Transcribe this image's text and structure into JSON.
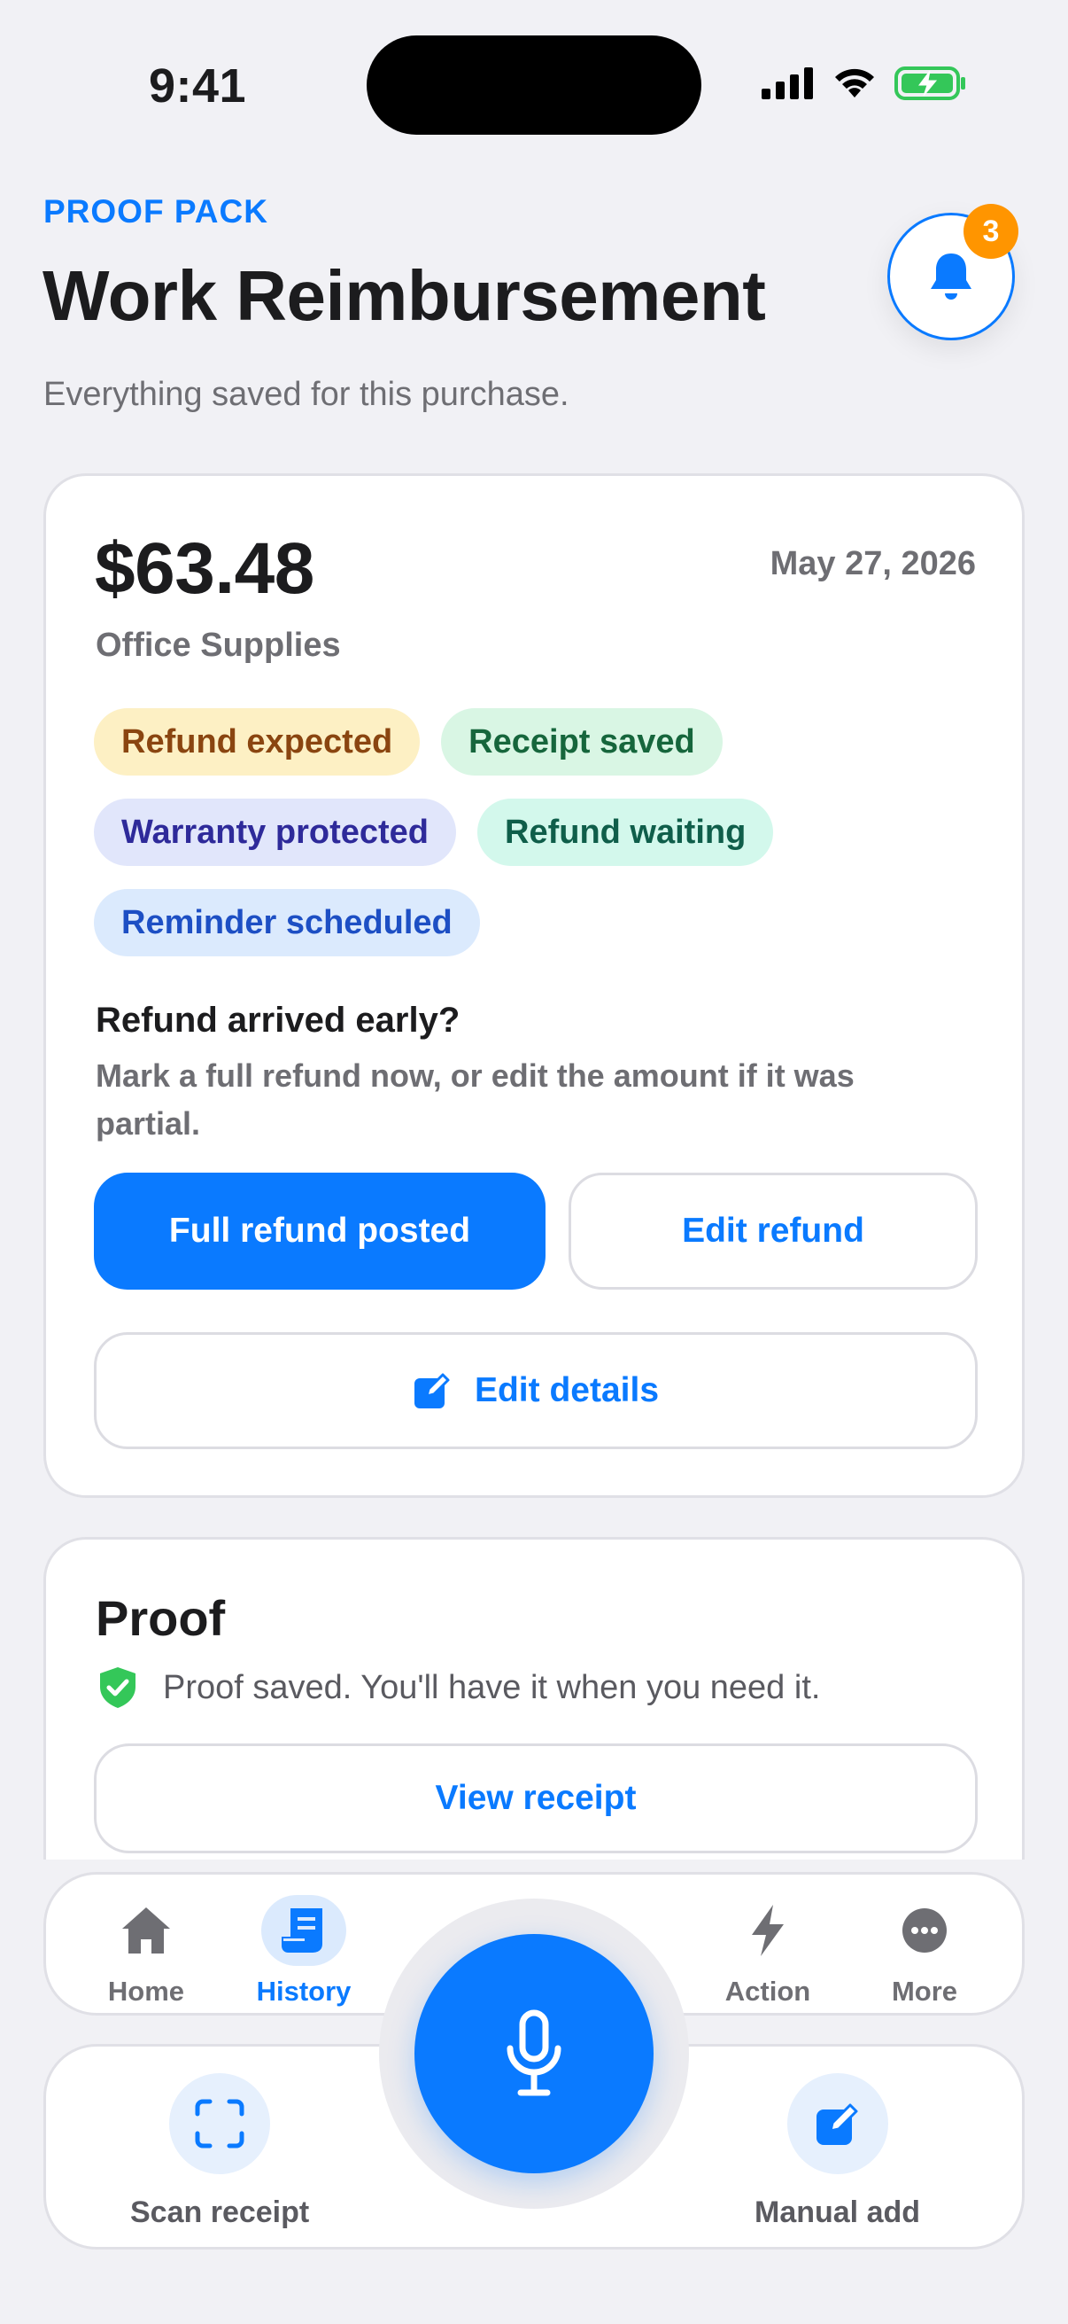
{
  "status_bar": {
    "time": "9:41"
  },
  "header": {
    "eyebrow": "PROOF PACK",
    "title": "Work Reimbursement",
    "subtitle": "Everything saved for this purchase.",
    "notification_count": "3"
  },
  "purchase": {
    "amount": "$63.48",
    "date": "May 27, 2026",
    "category": "Office Supplies",
    "chips": [
      {
        "label": "Refund expected",
        "color": "#fdf0c4"
      },
      {
        "label": "Receipt saved",
        "color": "#d9f6e4"
      },
      {
        "label": "Warranty protected",
        "color": "#e1e6fb"
      },
      {
        "label": "Refund waiting",
        "color": "#d3f8ec"
      },
      {
        "label": "Reminder scheduled",
        "color": "#dbeafd"
      }
    ],
    "question_title": "Refund arrived early?",
    "question_body": "Mark a full refund now, or edit the amount if it was partial.",
    "full_refund_label": "Full refund posted",
    "edit_refund_label": "Edit refund",
    "edit_details_label": "Edit details"
  },
  "proof": {
    "title": "Proof",
    "status": "Proof saved. You'll have it when you need it.",
    "view_receipt_label": "View receipt"
  },
  "tabbar": {
    "home": "Home",
    "history": "History",
    "action": "Action",
    "more": "More",
    "active": "History"
  },
  "tray": {
    "scan_label": "Scan receipt",
    "manual_label": "Manual add"
  },
  "colors": {
    "accent": "#0a7aff",
    "badge": "#ff9500",
    "success": "#34c759"
  }
}
